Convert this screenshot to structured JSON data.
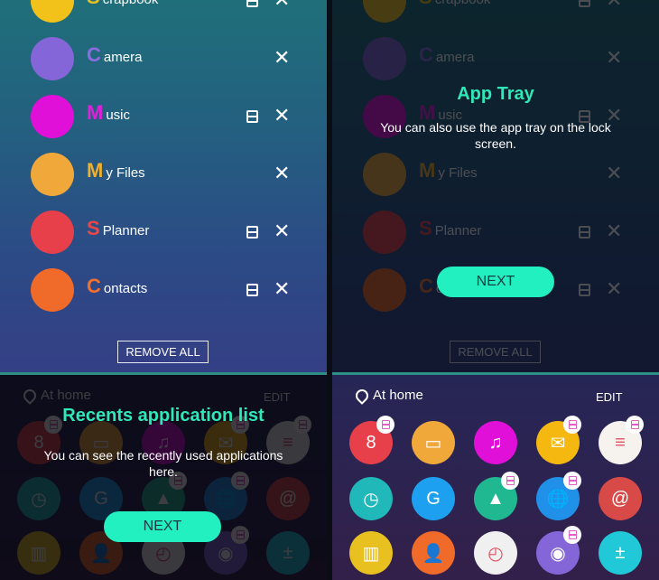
{
  "recents": [
    {
      "initial": "S",
      "rest": "crapbook",
      "letter_color": "#e8c020",
      "icon": "scrapbook-icon",
      "color": "#f2c21a",
      "split": true
    },
    {
      "initial": "C",
      "rest": "amera",
      "letter_color": "#8a6ee0",
      "icon": "camera-icon",
      "color": "#8466d8",
      "split": false
    },
    {
      "initial": "M",
      "rest": "usic",
      "letter_color": "#e020d8",
      "icon": "music-icon",
      "color": "#e010d8",
      "split": true
    },
    {
      "initial": "M",
      "rest": "y Files",
      "letter_color": "#f0b030",
      "icon": "my-files-icon",
      "color": "#f0a83a",
      "split": false
    },
    {
      "initial": "S",
      "rest": "Planner",
      "letter_color": "#e84848",
      "icon": "s-planner-icon",
      "color": "#e8404a",
      "split": true
    },
    {
      "initial": "C",
      "rest": "ontacts",
      "letter_color": "#f07030",
      "icon": "contacts-icon",
      "color": "#f06a2a",
      "split": true
    }
  ],
  "remove_all": "REMOVE ALL",
  "tray": {
    "location": "At home",
    "edit": "EDIT",
    "apps": [
      {
        "icon": "s-planner-icon",
        "color": "#e8404a",
        "glyph": "8",
        "badge": true
      },
      {
        "icon": "my-files-icon",
        "color": "#f0a83a",
        "glyph": "▭",
        "badge": false
      },
      {
        "icon": "music-icon",
        "color": "#e010d8",
        "glyph": "♫",
        "badge": false
      },
      {
        "icon": "email-icon",
        "color": "#f4b810",
        "glyph": "✉",
        "badge": true
      },
      {
        "icon": "memo-icon",
        "color": "#f6f2ee",
        "glyph": "≡",
        "badge": true
      },
      {
        "icon": "clock-widget-icon",
        "color": "#20b8b8",
        "glyph": "◷",
        "badge": false
      },
      {
        "icon": "galaxy-apps-icon",
        "color": "#1ea0f0",
        "glyph": "G",
        "badge": false
      },
      {
        "icon": "gallery-icon",
        "color": "#20b890",
        "glyph": "▲",
        "badge": true
      },
      {
        "icon": "internet-icon",
        "color": "#2090e8",
        "glyph": "🌐",
        "badge": true
      },
      {
        "icon": "email-at-icon",
        "color": "#d84a48",
        "glyph": "@",
        "badge": false
      },
      {
        "icon": "smart-remote-icon",
        "color": "#e8c020",
        "glyph": "▥",
        "badge": false
      },
      {
        "icon": "contacts-icon",
        "color": "#f06a2a",
        "glyph": "👤",
        "badge": false
      },
      {
        "icon": "clock-icon",
        "color": "#f0f0f0",
        "glyph": "◴",
        "badge": false
      },
      {
        "icon": "camera-icon",
        "color": "#8466d8",
        "glyph": "◉",
        "badge": true
      },
      {
        "icon": "calculator-icon",
        "color": "#20c8d8",
        "glyph": "±",
        "badge": false
      }
    ]
  },
  "tooltips": {
    "recents": {
      "title": "Recents application list",
      "body": "You can see the recently used applications here.",
      "button": "NEXT"
    },
    "app_tray": {
      "title": "App Tray",
      "body": "You can also use the app tray on the lock screen.",
      "button": "NEXT"
    }
  },
  "colors": {
    "accent": "#22f0c0",
    "title": "#2fe8b8"
  }
}
